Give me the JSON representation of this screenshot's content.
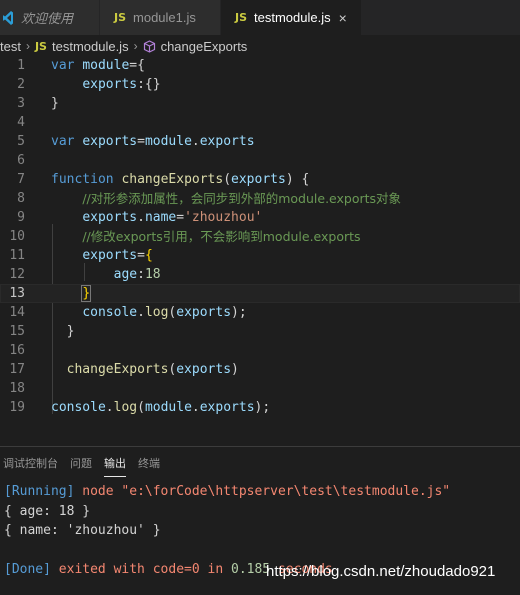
{
  "tabs": [
    {
      "label": "欢迎使用",
      "icon": "vscode-logo-icon"
    },
    {
      "label": "module1.js",
      "icon_text": "JS"
    },
    {
      "label": "testmodule.js",
      "icon_text": "JS",
      "close": "×"
    }
  ],
  "breadcrumb": {
    "folder": "test",
    "file_icon": "JS",
    "file": "testmodule.js",
    "symbol": "changeExports"
  },
  "editor": {
    "line_numbers": [
      "1",
      "2",
      "3",
      "4",
      "5",
      "6",
      "7",
      "8",
      "9",
      "10",
      "11",
      "12",
      "13",
      "14",
      "15",
      "16",
      "17",
      "18",
      "19"
    ],
    "tokens": {
      "l1_var": "var",
      "l1_module": "module",
      "l1_rest": "={",
      "l2_exports": "exports",
      "l2_rest": ":{}",
      "l3": "}",
      "l5_var": "var",
      "l5_exports": "exports",
      "l5_eq": "=",
      "l5_module": "module",
      "l5_dot": ".",
      "l5_exports2": "exports",
      "l7_function": "function",
      "l7_name": "changeExports",
      "l7_open": "(",
      "l7_param": "exports",
      "l7_close": ") {",
      "l8_comment": "//对形参添加属性，会同步到外部的module.exports对象",
      "l9_exports": "exports",
      "l9_dot": ".",
      "l9_name": "name",
      "l9_eq": "=",
      "l9_str": "'zhouzhou'",
      "l10_comment": "//修改exports引用，不会影响到module.exports",
      "l11_exports": "exports",
      "l11_eq": "=",
      "l11_brace": "{",
      "l12_age": "age",
      "l12_colon": ":",
      "l12_num": "18",
      "l13_brace": "}",
      "l14_console": "console",
      "l14_dot": ".",
      "l14_log": "log",
      "l14_open": "(",
      "l14_exports": "exports",
      "l14_close": ");",
      "l15": "}",
      "l17_call": "changeExports",
      "l17_open": "(",
      "l17_exports": "exports",
      "l17_close": ")",
      "l19_console": "console",
      "l19_dot": ".",
      "l19_log": "log",
      "l19_open": "(",
      "l19_module": "module",
      "l19_dot2": ".",
      "l19_exports": "exports",
      "l19_close": ");"
    }
  },
  "panel": {
    "tabs": [
      "调试控制台",
      "问题",
      "输出",
      "终端"
    ],
    "active_tab": "输出",
    "output": {
      "running_tag": "[Running]",
      "running_cmd": " node \"e:\\forCode\\httpserver\\test\\testmodule.js\"",
      "line2": "{ age: 18 }",
      "line3": "{ name: 'zhouzhou' }",
      "done_tag": "[Done]",
      "done_exited": " exited with ",
      "done_code": "code=0",
      "done_in": " in ",
      "done_secs": "0.185",
      "done_seconds": " seconds"
    }
  },
  "watermark": "https://blog.csdn.net/zhoudado921",
  "colors": {
    "background": "#1e1e1e",
    "keyword": "#569cd6",
    "variable": "#9cdcfe",
    "function": "#dcdcaa",
    "string": "#ce9178",
    "comment": "#6a9955",
    "js_icon": "#cbcb41"
  }
}
